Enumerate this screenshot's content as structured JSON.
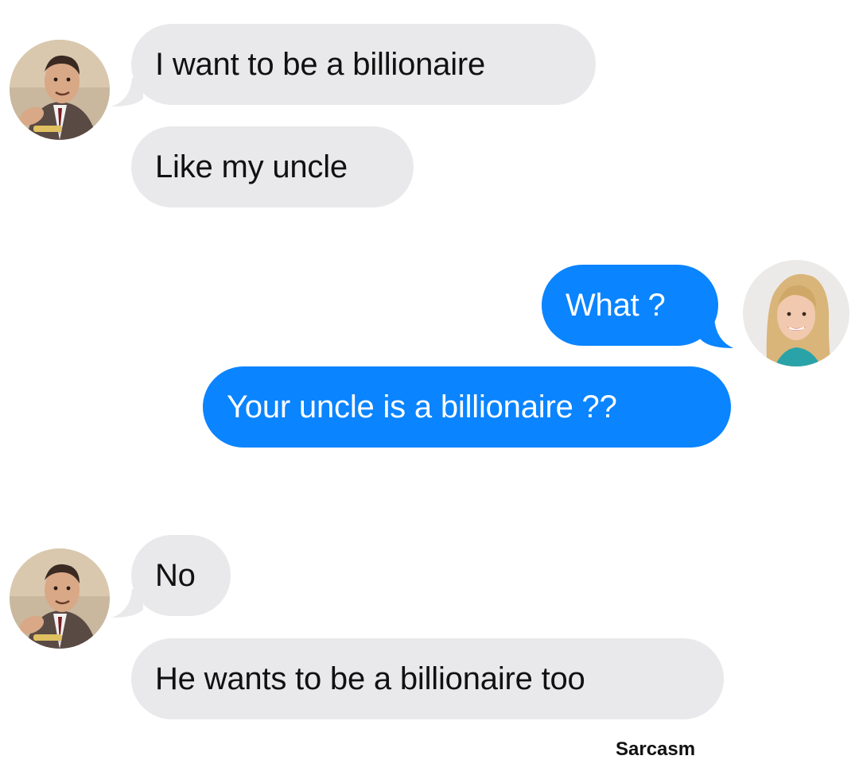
{
  "conversation": {
    "contact": {
      "avatar_icon": "man-avatar-icon"
    },
    "user": {
      "avatar_icon": "woman-avatar-icon"
    },
    "messages": [
      {
        "sender": "contact",
        "text": "I want to be a billionaire"
      },
      {
        "sender": "contact",
        "text": "Like my uncle"
      },
      {
        "sender": "user",
        "text": "What ?"
      },
      {
        "sender": "user",
        "text": "Your uncle is a billionaire ??"
      },
      {
        "sender": "contact",
        "text": "No"
      },
      {
        "sender": "contact",
        "text": "He wants to be a billionaire too"
      }
    ]
  },
  "watermark": {
    "text": "Sarcasm"
  },
  "colors": {
    "incoming_bubble": "#e9e9eb",
    "outgoing_bubble": "#0a84ff",
    "background": "#ffffff"
  }
}
